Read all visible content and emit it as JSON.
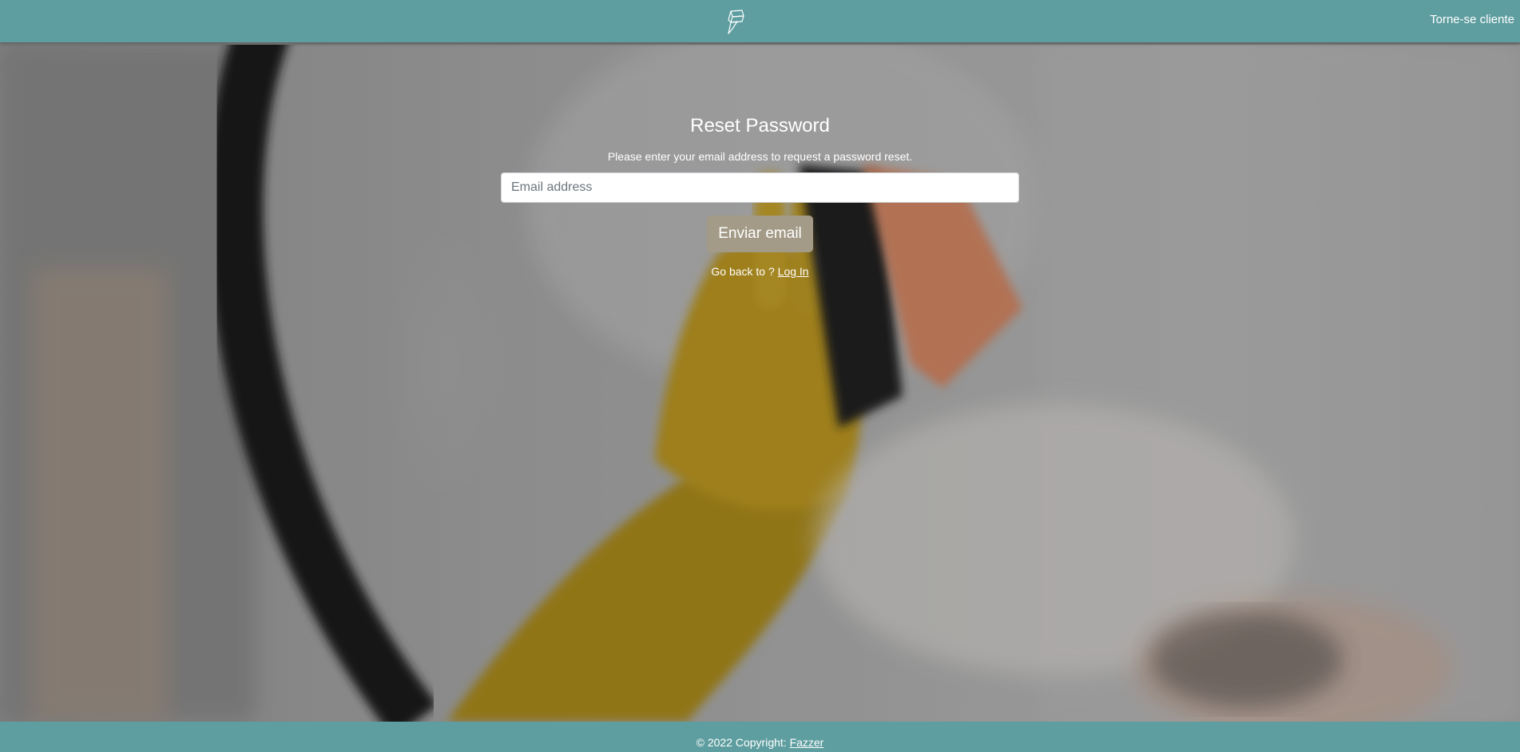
{
  "header": {
    "logo_icon": "fazzer-logo-icon",
    "nav_link_label": "Torne-se cliente",
    "background_color": "#5f9ea0"
  },
  "form": {
    "title": "Reset Password",
    "subtitle": "Please enter your email address to request a password reset.",
    "email_placeholder": "Email address",
    "email_value": "",
    "submit_label": "Enviar email",
    "submit_color": "#a39b87",
    "back_prefix": "Go back to ?",
    "back_link_label": "Log In"
  },
  "footer": {
    "copyright_text": "© 2022 Copyright:",
    "brand_link_label": "Fazzer"
  }
}
